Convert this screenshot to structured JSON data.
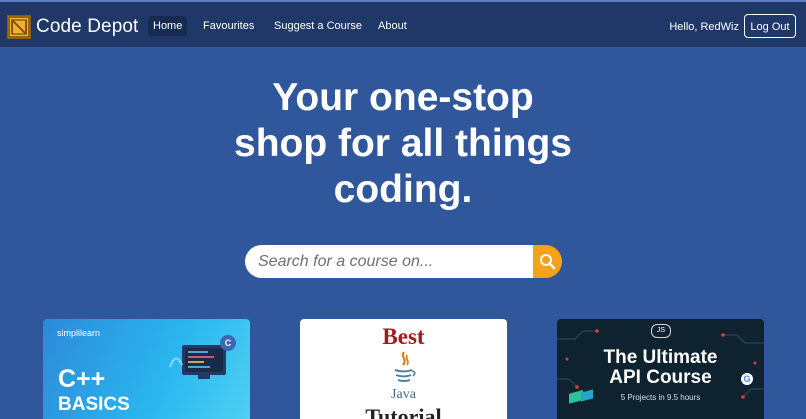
{
  "navbar": {
    "brand": "Code Depot",
    "links": [
      "Home",
      "Favourites",
      "Suggest a Course",
      "About"
    ],
    "greeting": "Hello, RedWiz",
    "logout_label": "Log Out"
  },
  "hero": {
    "lines": [
      "Your one-stop",
      "shop for all things",
      "coding."
    ]
  },
  "search": {
    "placeholder": "Search for a course on..."
  },
  "cards": [
    {
      "brand": "simplilearn",
      "title": "C++",
      "subtitle": "BASICS"
    },
    {
      "title": "Best",
      "logo_text": "Java",
      "subtitle": "Tutorial"
    },
    {
      "badge": "JS",
      "title_lines": [
        "The Ultimate",
        "API Course"
      ],
      "subtitle": "5 Projects in 9.5 hours"
    }
  ],
  "colors": {
    "page_bg": "#30569b",
    "navbar_bg": "#1f3868",
    "accent": "#f5a11a"
  },
  "icons": [
    "crate-logo-icon",
    "search-icon",
    "java-cup-icon",
    "google-icon"
  ]
}
